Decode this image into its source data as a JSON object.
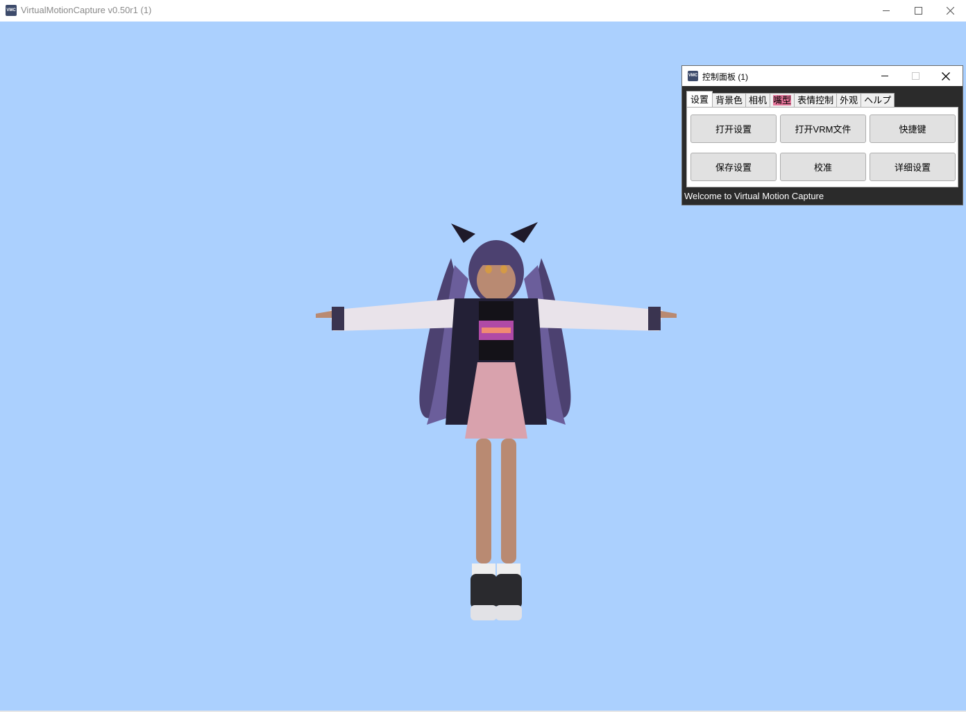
{
  "window": {
    "title": "VirtualMotionCapture v0.50r1 (1)",
    "icon": "vmc-app-icon",
    "icon_text": "VMC",
    "controls": [
      "minimize-icon",
      "maximize-icon",
      "close-icon"
    ]
  },
  "viewport": {
    "background_color": "#abd0fe",
    "content": "vrm-avatar-t-pose"
  },
  "control_panel": {
    "title": "控制面板 (1)",
    "icon": "vmc-app-icon",
    "icon_text": "VMC",
    "controls": [
      "minimize-icon",
      "maximize-icon-disabled",
      "close-icon"
    ],
    "tabs": [
      {
        "label": "设置",
        "active": true
      },
      {
        "label": "背景色",
        "active": false
      },
      {
        "label": "相机",
        "active": false
      },
      {
        "label": "嘴型",
        "active": false,
        "highlight_color": "#e6749a"
      },
      {
        "label": "表情控制",
        "active": false
      },
      {
        "label": "外观",
        "active": false
      },
      {
        "label": "ヘルプ",
        "active": false
      }
    ],
    "buttons": [
      {
        "label": "打开设置"
      },
      {
        "label": "打开VRM文件"
      },
      {
        "label": "快捷键"
      },
      {
        "label": "保存设置"
      },
      {
        "label": "校准"
      },
      {
        "label": "详细设置"
      }
    ],
    "status_text": "Welcome to Virtual Motion Capture",
    "background_color": "#2b2b2b"
  }
}
